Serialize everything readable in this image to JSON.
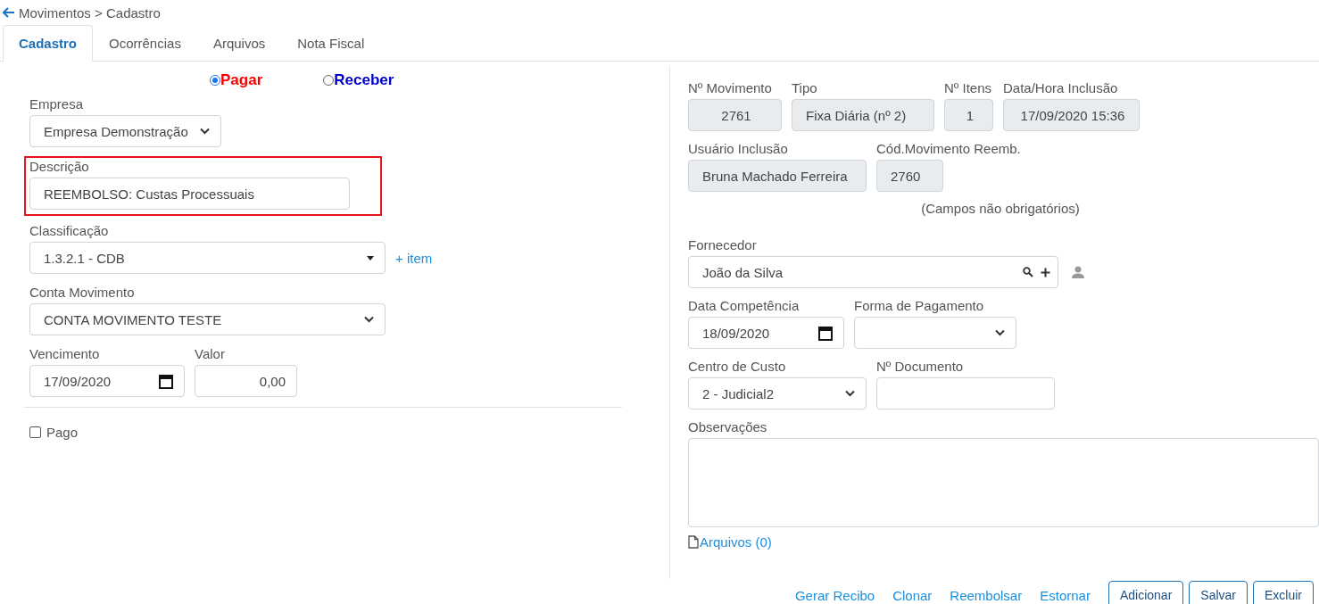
{
  "breadcrumb": "Movimentos > Cadastro",
  "tabs": [
    {
      "label": "Cadastro",
      "selected": true
    },
    {
      "label": "Ocorrências",
      "selected": false
    },
    {
      "label": "Arquivos",
      "selected": false
    },
    {
      "label": "Nota Fiscal",
      "selected": false
    }
  ],
  "type_options": [
    {
      "label": "Pagar",
      "selected": true,
      "color": "#ff0000"
    },
    {
      "label": "Receber",
      "selected": false,
      "color": "#0000cc"
    }
  ],
  "left_rows": [
    {
      "highlighted": false,
      "fields": [
        {
          "label": "Empresa",
          "kind": "select",
          "value": "Empresa Demonstração",
          "readonly": false
        }
      ]
    },
    {
      "highlighted": true,
      "fields": [
        {
          "label": "Descrição",
          "kind": "text",
          "value": "REEMBOLSO: Custas Processuais",
          "readonly": false
        }
      ]
    },
    {
      "highlighted": false,
      "fields": [
        {
          "label": "Classificação",
          "kind": "combo",
          "value": "1.3.2.1 - CDB",
          "readonly": false,
          "link": "+ item"
        }
      ]
    },
    {
      "highlighted": false,
      "fields": [
        {
          "label": "Conta Movimento",
          "kind": "select",
          "value": "CONTA MOVIMENTO TESTE",
          "readonly": false
        }
      ]
    },
    {
      "highlighted": false,
      "fields": [
        {
          "label": "Vencimento",
          "kind": "date",
          "value": "17/09/2020",
          "readonly": false
        },
        {
          "label": "Valor",
          "kind": "number",
          "value": "0,00",
          "readonly": false
        }
      ]
    }
  ],
  "paid": {
    "label": "Pago",
    "checked": false
  },
  "right_rows": [
    {
      "kind": "fields",
      "fields": [
        {
          "label": "Nº Movimento",
          "kind": "text",
          "value": "2761",
          "readonly": true
        },
        {
          "label": "Tipo",
          "kind": "text",
          "value": "Fixa Diária (nº 2)",
          "readonly": true
        },
        {
          "label": "Nº Itens",
          "kind": "text",
          "value": "1",
          "readonly": true
        },
        {
          "label": "Data/Hora Inclusão",
          "kind": "text",
          "value": "17/09/2020 15:36",
          "readonly": true
        }
      ]
    },
    {
      "kind": "fields",
      "fields": [
        {
          "label": "Usuário Inclusão",
          "kind": "text",
          "value": "Bruna Machado Ferreira",
          "readonly": true
        },
        {
          "label": "Cód.Movimento Reemb.",
          "kind": "text",
          "value": "2760",
          "readonly": true
        }
      ]
    },
    {
      "kind": "note",
      "text": "(Campos não obrigatórios)"
    },
    {
      "kind": "fields",
      "fields": [
        {
          "label": "Fornecedor",
          "kind": "lookup",
          "value": "João da Silva",
          "readonly": false
        }
      ]
    },
    {
      "kind": "fields",
      "fields": [
        {
          "label": "Data Competência",
          "kind": "date",
          "value": "18/09/2020",
          "readonly": false
        },
        {
          "label": "Forma de Pagamento",
          "kind": "select",
          "readonly": false
        }
      ]
    },
    {
      "kind": "fields",
      "fields": [
        {
          "label": "Centro de Custo",
          "kind": "select",
          "value": "2 - Judicial2",
          "readonly": false
        },
        {
          "label": "Nº Documento",
          "kind": "text",
          "readonly": false
        }
      ]
    },
    {
      "kind": "fields",
      "fields": [
        {
          "label": "Observações",
          "kind": "textarea",
          "readonly": false
        }
      ]
    },
    {
      "kind": "attachments",
      "text": "Arquivos (0)"
    }
  ],
  "actions": [
    {
      "kind": "link",
      "label": "Gerar Recibo"
    },
    {
      "kind": "link",
      "label": "Clonar"
    },
    {
      "kind": "link",
      "label": "Reembolsar"
    },
    {
      "kind": "link",
      "label": "Estornar"
    },
    {
      "kind": "button",
      "label": "Adicionar"
    },
    {
      "kind": "button",
      "label": "Salvar"
    },
    {
      "kind": "button",
      "label": "Excluir"
    }
  ]
}
